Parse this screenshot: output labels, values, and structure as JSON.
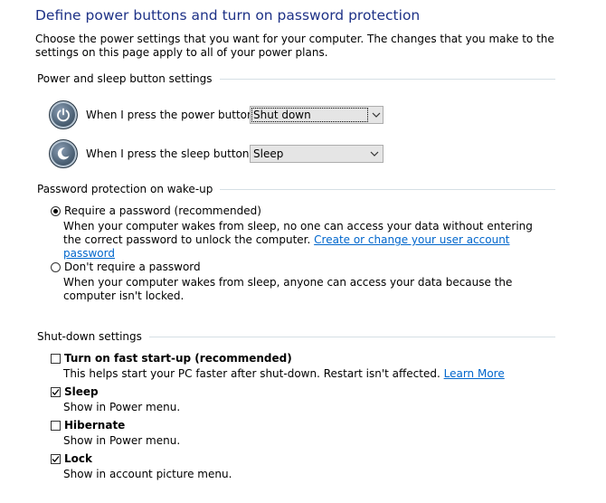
{
  "page": {
    "title": "Define power buttons and turn on password protection",
    "intro": "Choose the power settings that you want for your computer. The changes that you make to the settings on this page apply to all of your power plans."
  },
  "power_sleep": {
    "header": "Power and sleep button settings",
    "power_label": "When I press the power button:",
    "power_value": "Shut down",
    "sleep_label": "When I press the sleep button:",
    "sleep_value": "Sleep"
  },
  "password": {
    "header": "Password protection on wake-up",
    "require_label": "Require a password (recommended)",
    "require_desc": "When your computer wakes from sleep, no one can access your data without entering the correct password to unlock the computer.",
    "require_link": "Create or change your user account password",
    "norequire_label": "Don't require a password",
    "norequire_desc": "When your computer wakes from sleep, anyone can access your data because the computer isn't locked.",
    "selected": "require"
  },
  "shutdown": {
    "header": "Shut-down settings",
    "items": [
      {
        "label": "Turn on fast start-up (recommended)",
        "desc": "This helps start your PC faster after shut-down. Restart isn't affected.",
        "link": "Learn More",
        "checked": false
      },
      {
        "label": "Sleep",
        "desc": "Show in Power menu.",
        "checked": true
      },
      {
        "label": "Hibernate",
        "desc": "Show in Power menu.",
        "checked": false
      },
      {
        "label": "Lock",
        "desc": "Show in account picture menu.",
        "checked": true
      }
    ]
  },
  "colors": {
    "title": "#1e3287",
    "link": "#0066cc",
    "rule": "#d5dfe5"
  },
  "icons": {
    "power": "power-icon",
    "sleep": "moon-icon",
    "dropdown": "chevron-down-icon",
    "check": "checkmark-icon"
  }
}
